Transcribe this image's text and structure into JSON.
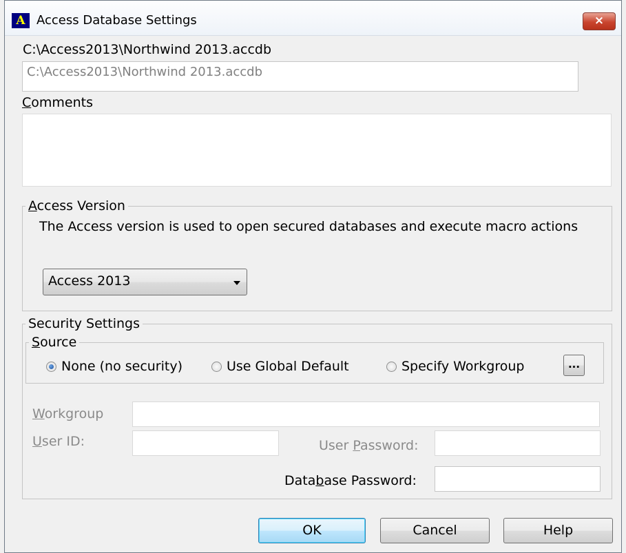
{
  "window": {
    "title": "Access Database Settings",
    "icon_glyph": "A",
    "close_glyph": "×"
  },
  "database": {
    "path_label": "C:\\Access2013\\Northwind 2013.accdb",
    "path_value": "C:\\Access2013\\Northwind 2013.accdb"
  },
  "comments": {
    "label_first": "C",
    "label_rest": "omments",
    "value": ""
  },
  "access_version": {
    "legend_first": "A",
    "legend_rest": "ccess Version",
    "description": "The Access version is used to open secured databases and execute macro actions",
    "selected": "Access 2013"
  },
  "security": {
    "legend": "Security Settings",
    "source_legend_first": "S",
    "source_legend_rest": "ource",
    "options": [
      "None (no security)",
      "Use Global Default",
      "Specify Workgroup"
    ],
    "selected_index": 0,
    "browse_label": "...",
    "workgroup_label_first": "W",
    "workgroup_label_rest": "orkgroup",
    "user_id_label_first": "U",
    "user_id_label_rest": "ser ID:",
    "user_password_label_a": "User ",
    "user_password_label_u": "P",
    "user_password_label_b": "assword:",
    "db_password_label_a": "Data",
    "db_password_label_u": "b",
    "db_password_label_b": "ase Password:",
    "workgroup_value": "",
    "user_id_value": "",
    "user_password_value": "",
    "db_password_value": ""
  },
  "buttons": {
    "ok": "OK",
    "cancel": "Cancel",
    "help": "Help"
  }
}
